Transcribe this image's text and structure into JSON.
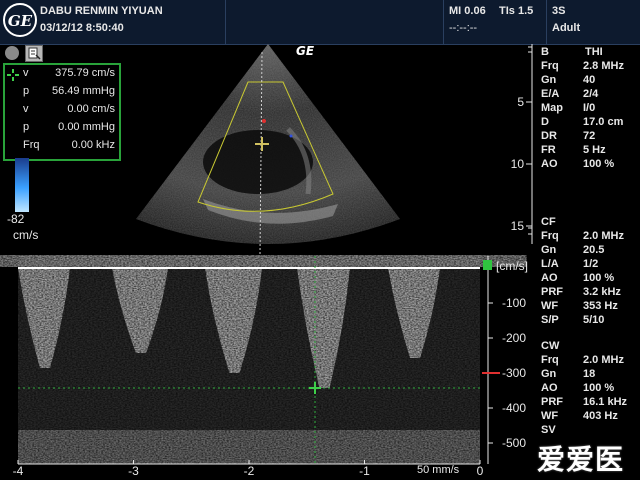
{
  "header": {
    "hospital": "DABU RENMIN YIYUAN",
    "datetime": "03/12/12 8:50:40",
    "mi": "MI 0.06",
    "tis": "TIs 1.5",
    "tis_sub": "--:--:--",
    "probe": "3S",
    "preset": "Adult",
    "logo": "GE"
  },
  "toolbar": {
    "record_icon": "circle-icon",
    "report_icon": "report-icon"
  },
  "measurements": {
    "rows": [
      {
        "label": "v",
        "value": "375.79 cm/s"
      },
      {
        "label": "p",
        "value": "56.49 mmHg"
      },
      {
        "label": "v",
        "value": "0.00 cm/s"
      },
      {
        "label": "p",
        "value": "0.00 mmHg"
      },
      {
        "label": "Frq",
        "value": "0.00 kHz"
      }
    ]
  },
  "color_scale": {
    "min_label": "-82",
    "unit": "cm/s"
  },
  "sector": {
    "logo": "GE",
    "depth_ticks": [
      "5",
      "10",
      "15"
    ],
    "depth_percent": [
      0.29,
      0.6,
      0.91
    ]
  },
  "params_bmode": {
    "title": "B",
    "title_value": "THI",
    "rows": [
      {
        "k": "Frq",
        "v": "2.8 MHz"
      },
      {
        "k": "Gn",
        "v": "40"
      },
      {
        "k": "E/A",
        "v": "2/4"
      },
      {
        "k": "Map",
        "v": "I/0"
      },
      {
        "k": "D",
        "v": "17.0 cm"
      },
      {
        "k": "DR",
        "v": "72"
      },
      {
        "k": "FR",
        "v": "5 Hz"
      },
      {
        "k": "AO",
        "v": "100 %"
      }
    ]
  },
  "params_cf": {
    "title": "CF",
    "rows": [
      {
        "k": "Frq",
        "v": "2.0 MHz"
      },
      {
        "k": "Gn",
        "v": "20.5"
      },
      {
        "k": "L/A",
        "v": "1/2"
      },
      {
        "k": "AO",
        "v": "100 %"
      },
      {
        "k": "PRF",
        "v": "3.2 kHz"
      },
      {
        "k": "WF",
        "v": "353 Hz"
      },
      {
        "k": "S/P",
        "v": "5/10"
      }
    ]
  },
  "params_cw": {
    "title": "CW",
    "rows": [
      {
        "k": "Frq",
        "v": "2.0 MHz"
      },
      {
        "k": "Gn",
        "v": "18"
      },
      {
        "k": "AO",
        "v": "100 %"
      },
      {
        "k": "PRF",
        "v": "16.1 kHz"
      },
      {
        "k": "WF",
        "v": "403 Hz"
      },
      {
        "k": "SV",
        "v": ""
      }
    ]
  },
  "doppler": {
    "unit_label": "[cm/s]",
    "y_ticks": [
      "-100",
      "-200",
      "-300",
      "-400",
      "-500"
    ],
    "y_values": [
      -100,
      -200,
      -300,
      -400,
      -500
    ],
    "y_range": [
      0,
      -560
    ],
    "x_ticks": [
      "-4",
      "-3",
      "-2",
      "-1",
      "0"
    ],
    "x_values": [
      -4,
      -3,
      -2,
      -1,
      0
    ],
    "x_range": [
      -4,
      0
    ],
    "sweep_speed": "50 mms /s",
    "sweep_label": "50 mm/s",
    "baseline_marker_value": -300
  },
  "watermark": "爱爱医"
}
